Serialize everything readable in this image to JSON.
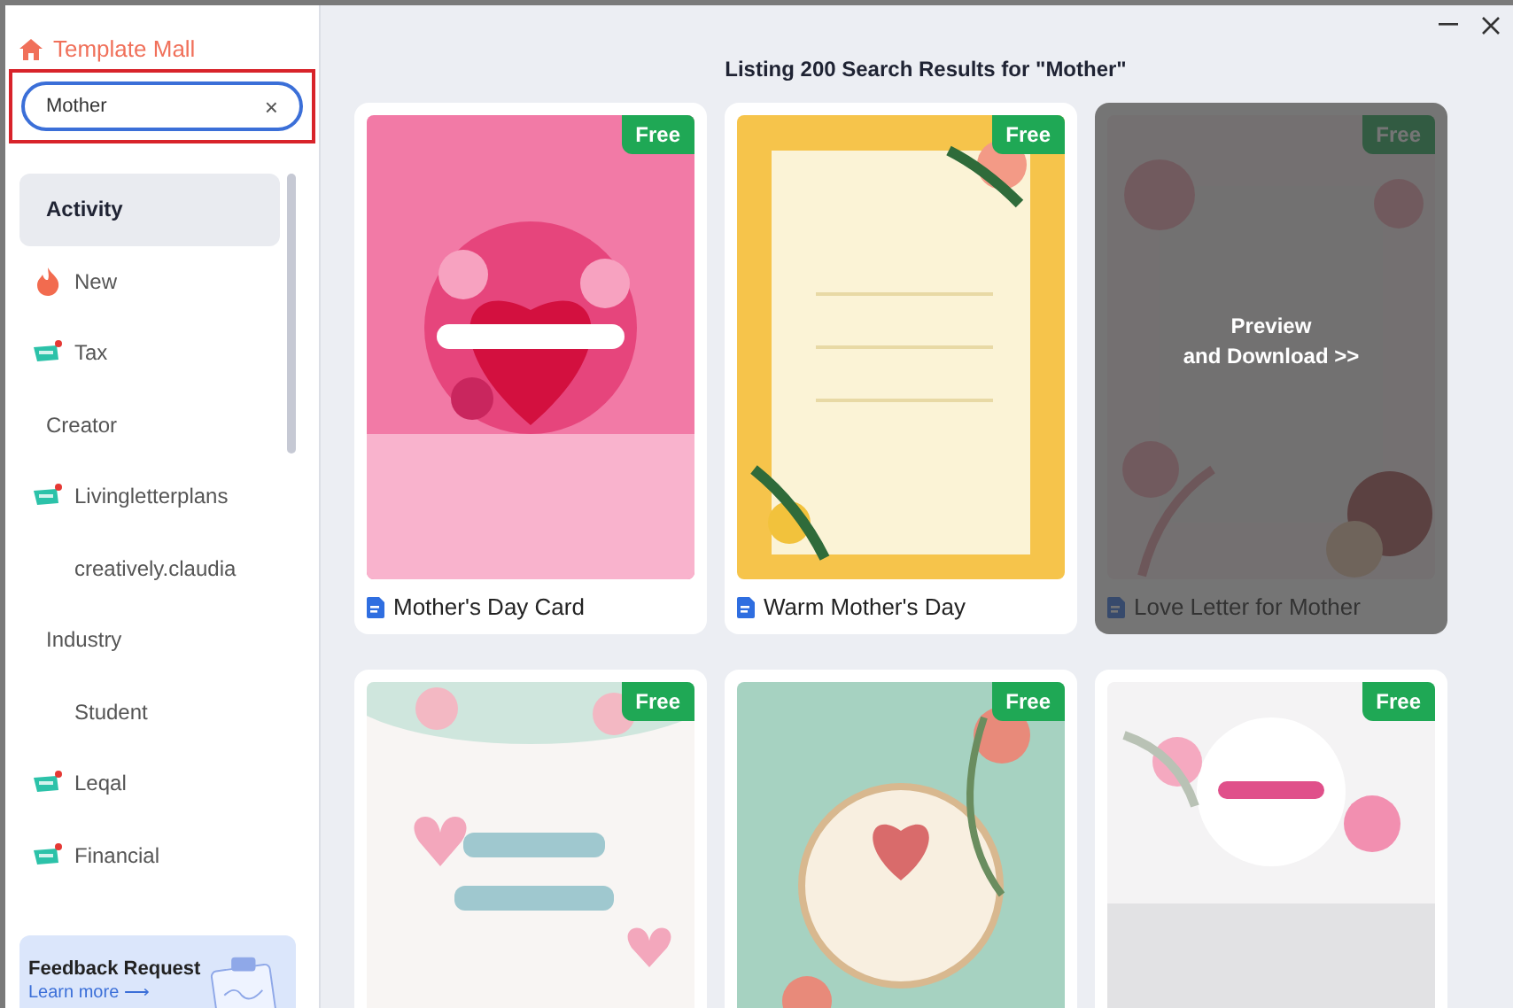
{
  "sidebar": {
    "title": "Template Mall",
    "search": {
      "value": "Mother",
      "clear": "×",
      "highlighted": true
    },
    "items": [
      {
        "label": "Activity",
        "selected": true,
        "children": [
          {
            "label": "New",
            "kind": "hot",
            "selected": false
          },
          {
            "label": "Tax",
            "kind": "badged",
            "selected": false
          }
        ]
      },
      {
        "label": "Creator",
        "selected": false,
        "children": [
          {
            "label": "Livingletterplans",
            "kind": "badged",
            "selected": false
          },
          {
            "label": "creatively.claudia",
            "kind": "plain",
            "selected": false
          }
        ]
      },
      {
        "label": "Industry",
        "selected": false,
        "children": [
          {
            "label": "Student",
            "kind": "plain",
            "selected": false
          },
          {
            "label": "Leqal",
            "kind": "badged",
            "selected": false
          },
          {
            "label": "Financial",
            "kind": "badged",
            "selected": false
          }
        ]
      }
    ],
    "feedback": {
      "title": "Feedback Request",
      "link": "Learn more ⟶"
    }
  },
  "results": {
    "heading": "Listing 200 Search Results for \"Mother\"",
    "cards": [
      {
        "badge": "Free",
        "title": "Mother's Day Card",
        "hovered": false
      },
      {
        "badge": "Free",
        "title": "Warm Mother's Day",
        "hovered": false
      },
      {
        "badge": "Free",
        "title": "Love Letter for Mother",
        "hovered": true,
        "overlay": "Preview\nand Download >>"
      },
      {
        "badge": "Free",
        "hovered": false
      },
      {
        "badge": "Free",
        "hovered": false
      },
      {
        "badge": "Free",
        "hovered": false
      }
    ]
  }
}
